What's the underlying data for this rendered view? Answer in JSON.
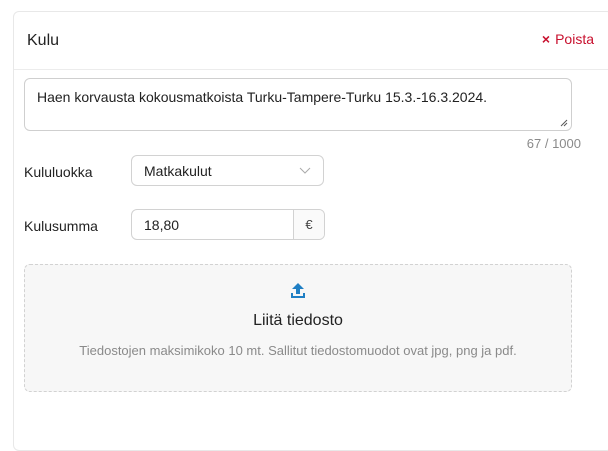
{
  "card": {
    "title": "Kulu",
    "remove_label": "Poista",
    "remove_icon": "×",
    "accent_color": "#c8102e"
  },
  "description": {
    "value": "Haen korvausta kokousmatkoista Turku-Tampere-Turku 15.3.-16.3.2024.",
    "char_count": "67 / 1000"
  },
  "category": {
    "label": "Kululuokka",
    "selected": "Matkakulut"
  },
  "amount": {
    "label": "Kulusumma",
    "value": "18,80",
    "currency": "€"
  },
  "attachment": {
    "title": "Liitä tiedosto",
    "hint": "Tiedostojen maksimikoko 10 mt. Sallitut tiedostomuodot ovat jpg, png ja pdf.",
    "icon": "upload-icon",
    "icon_color": "#1f7fc4"
  }
}
